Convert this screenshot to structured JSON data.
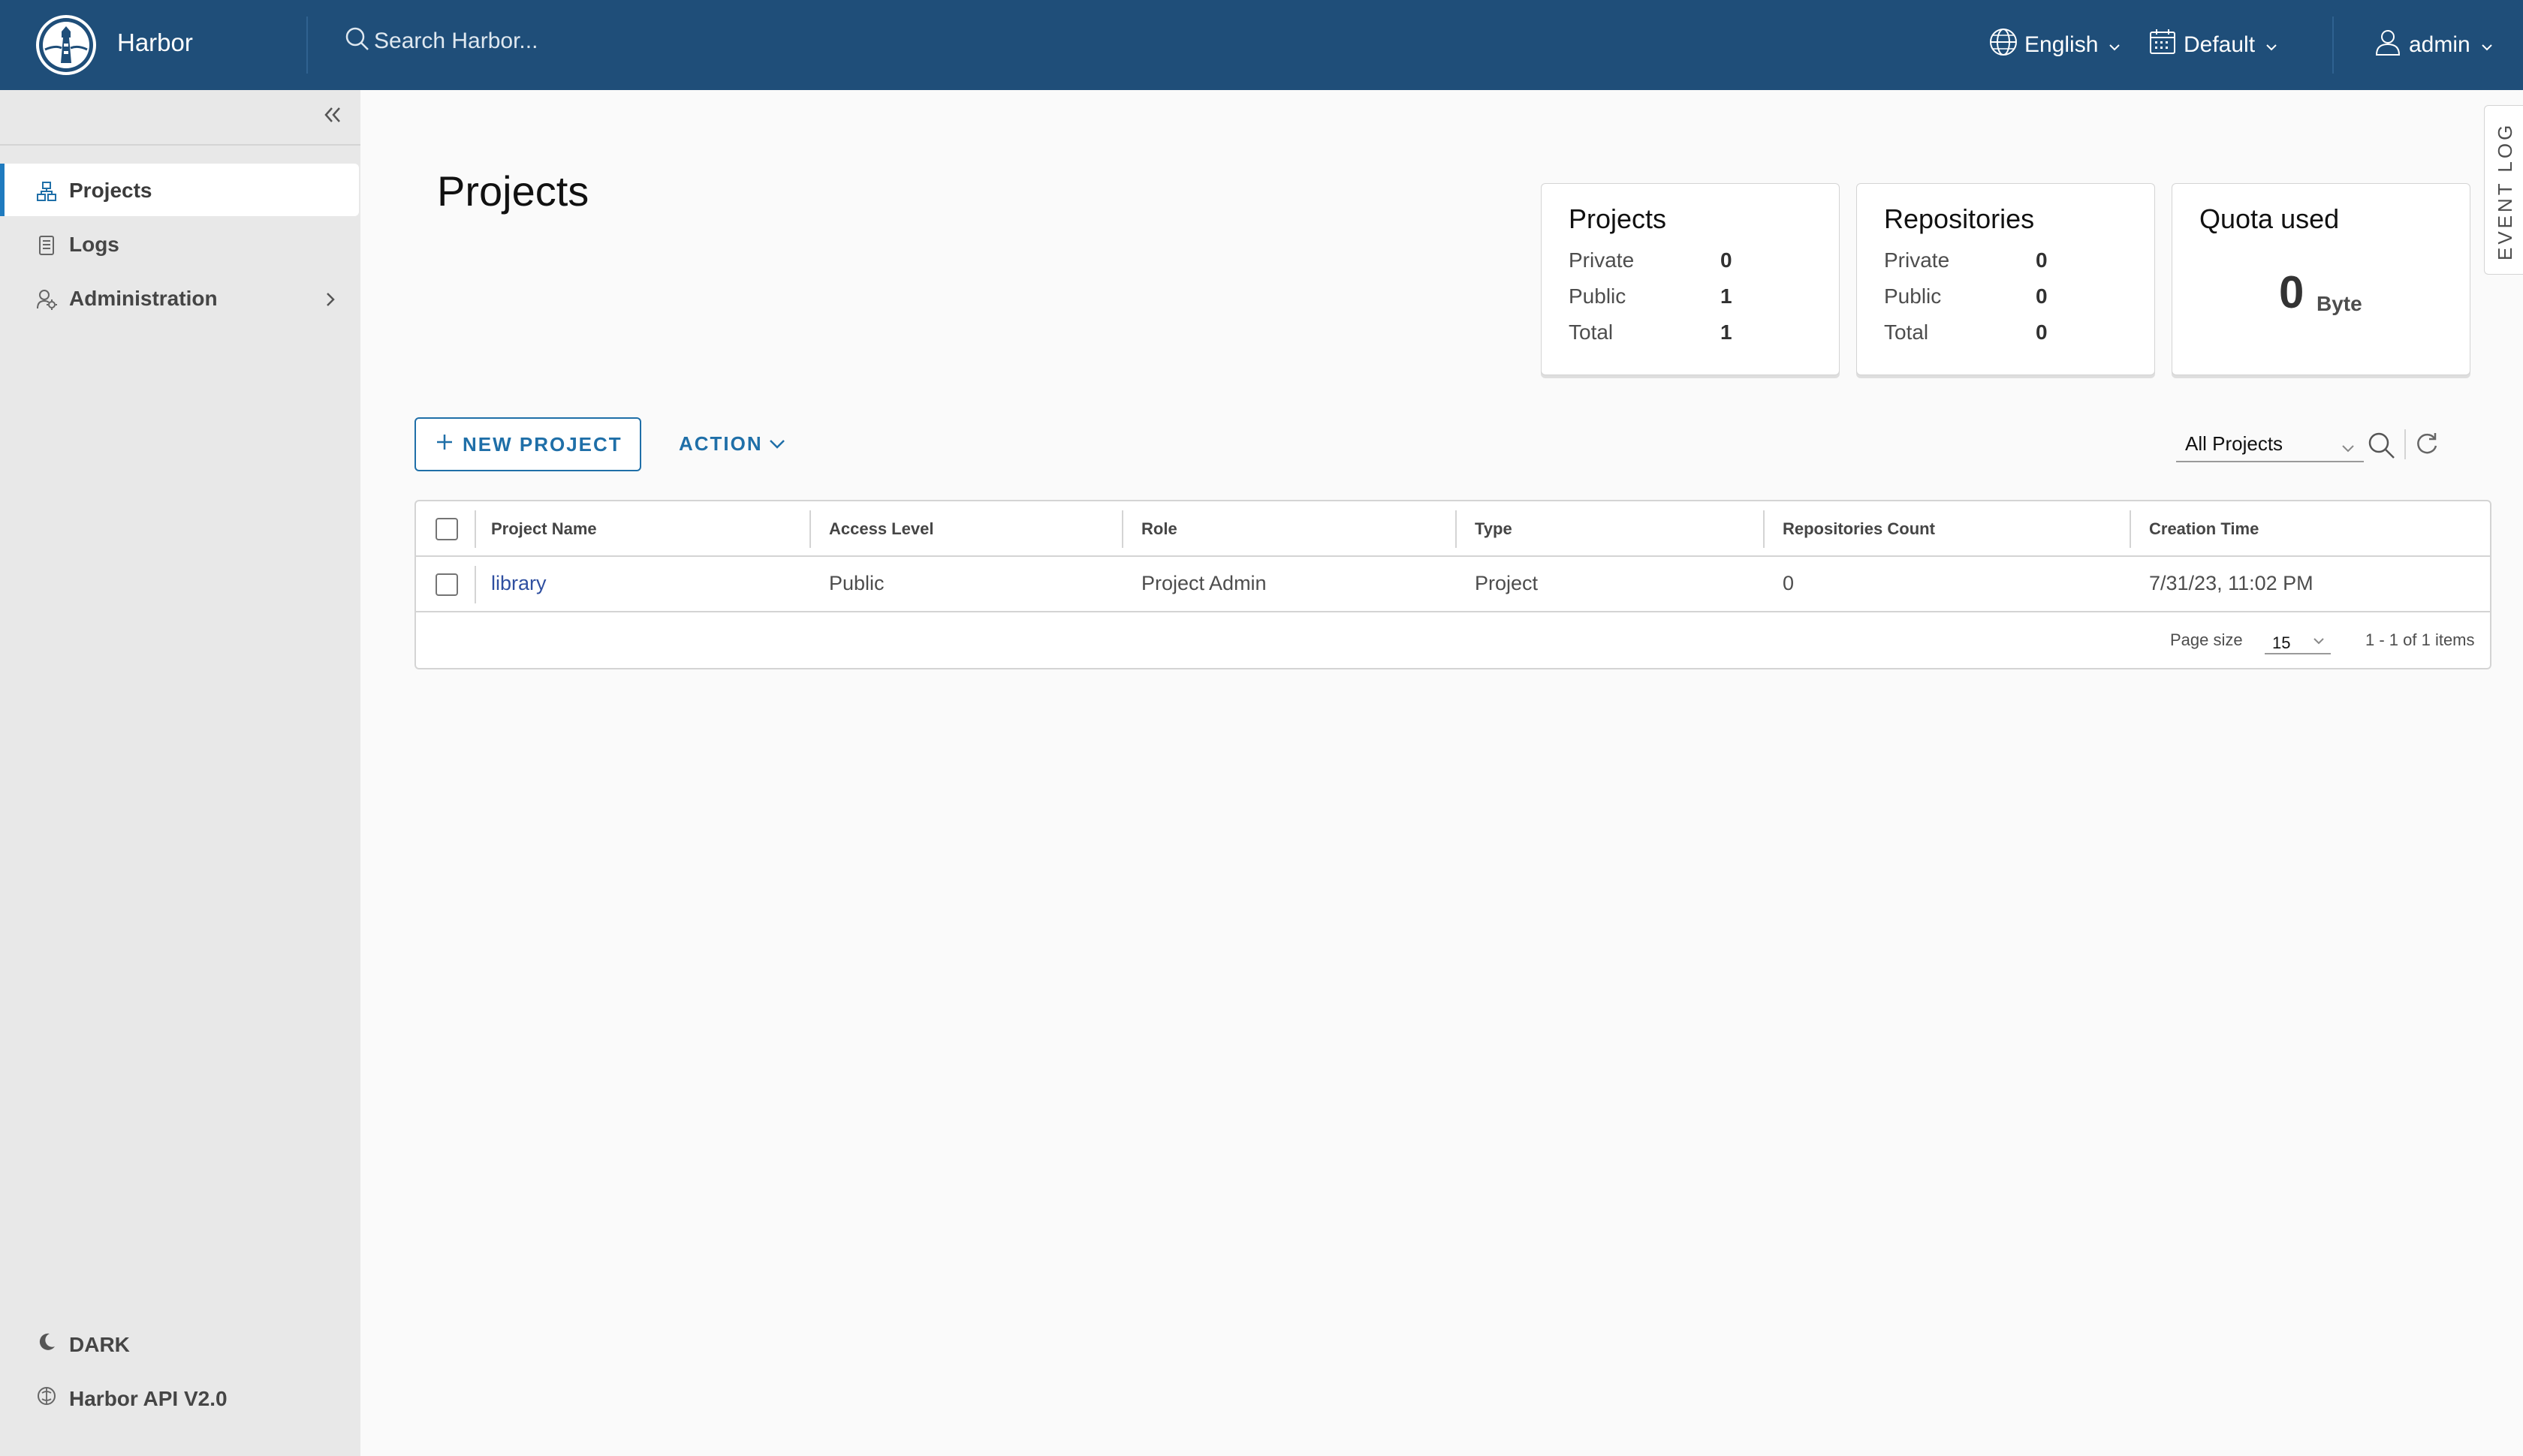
{
  "header": {
    "app_name": "Harbor",
    "search_placeholder": "Search Harbor...",
    "language": "English",
    "theme": "Default",
    "user": "admin"
  },
  "sidebar": {
    "items": [
      {
        "label": "Projects",
        "icon": "projects-icon",
        "active": true
      },
      {
        "label": "Logs",
        "icon": "logs-icon"
      },
      {
        "label": "Administration",
        "icon": "administration-icon"
      }
    ],
    "footer": {
      "dark_label": "DARK",
      "api_label": "Harbor API V2.0"
    }
  },
  "page": {
    "title": "Projects"
  },
  "summary": {
    "projects": {
      "title": "Projects",
      "private_label": "Private",
      "private": "0",
      "public_label": "Public",
      "public": "1",
      "total_label": "Total",
      "total": "1"
    },
    "repositories": {
      "title": "Repositories",
      "private_label": "Private",
      "private": "0",
      "public_label": "Public",
      "public": "0",
      "total_label": "Total",
      "total": "0"
    },
    "quota": {
      "title": "Quota used",
      "value": "0",
      "unit": "Byte"
    }
  },
  "event_log": "EVENT LOG",
  "toolbar": {
    "new_project": "NEW PROJECT",
    "action": "ACTION",
    "filter": "All Projects"
  },
  "table": {
    "headers": [
      "Project Name",
      "Access Level",
      "Role",
      "Type",
      "Repositories Count",
      "Creation Time"
    ],
    "rows": [
      {
        "name": "library",
        "access": "Public",
        "role": "Project Admin",
        "type": "Project",
        "repo_count": "0",
        "created": "7/31/23, 11:02 PM"
      }
    ],
    "page_size_label": "Page size",
    "page_size": "15",
    "count_text": "1 - 1 of 1 items"
  },
  "colors": {
    "header_bg": "#1f4e79",
    "accent": "#1f6fa8",
    "link": "#2f4fa0",
    "sidebar_bg": "#e8e8e8"
  }
}
